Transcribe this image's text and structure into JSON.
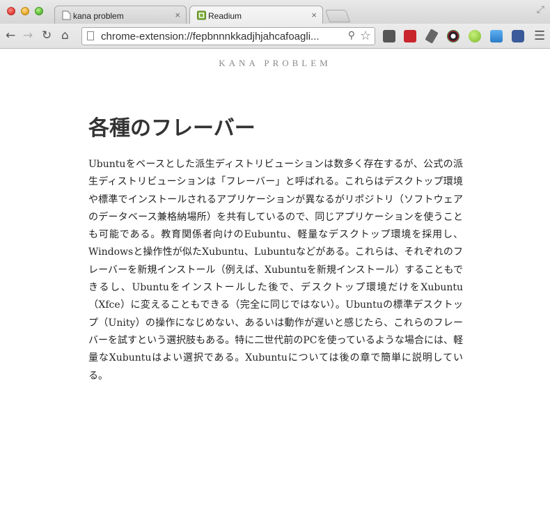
{
  "browser": {
    "tabs": [
      {
        "title": "kana problem",
        "close_glyph": "×",
        "active": false
      },
      {
        "title": "Readium",
        "close_glyph": "×",
        "active": true
      }
    ],
    "url": "chrome-extension://fepbnnnkkadjhjahcafoagli...",
    "icons": {
      "back": "←",
      "forward": "→",
      "reload": "↻",
      "home": "⌂",
      "zoom": "⚲",
      "star": "☆",
      "menu": "☰",
      "expand": "⤢"
    },
    "extension_icons": [
      "extension-icon",
      "red-extension-icon",
      "pin-extension-icon",
      "color-wheel-icon",
      "green-circle-icon",
      "picture-icon",
      "camera-icon"
    ]
  },
  "page": {
    "site_title": "KANA PROBLEM",
    "heading": "各種のフレーバー",
    "body": "Ubuntuをベースとした派生ディストリビューションは数多く存在するが、公式の派生ディストリビューションは「フレーバー」と呼ばれる。これらはデスクトップ環境や標準でインストールされるアプリケーションが異なるがリポジトリ（ソフトウェアのデータベース兼格納場所）を共有しているので、同じアプリケーションを使うことも可能である。教育関係者向けのEubuntu、軽量なデスクトップ環境を採用し、Windowsと操作性が似たXubuntu、Lubuntuなどがある。これらは、それぞれのフレーバーを新規インストール（例えば、Xubuntuを新規インストール）することもできるし、Ubuntuをインストールした後で、デスクトップ環境だけをXubuntu（Xfce）に変えることもできる（完全に同じではない）。Ubuntuの標準デスクトップ（Unity）の操作になじめない、あるいは動作が遅いと感じたら、これらのフレーバーを試すという選択肢もある。特に二世代前のPCを使っているような場合には、軽量なXubuntuはよい選択である。Xubuntuについては後の章で簡単に説明している。"
  }
}
